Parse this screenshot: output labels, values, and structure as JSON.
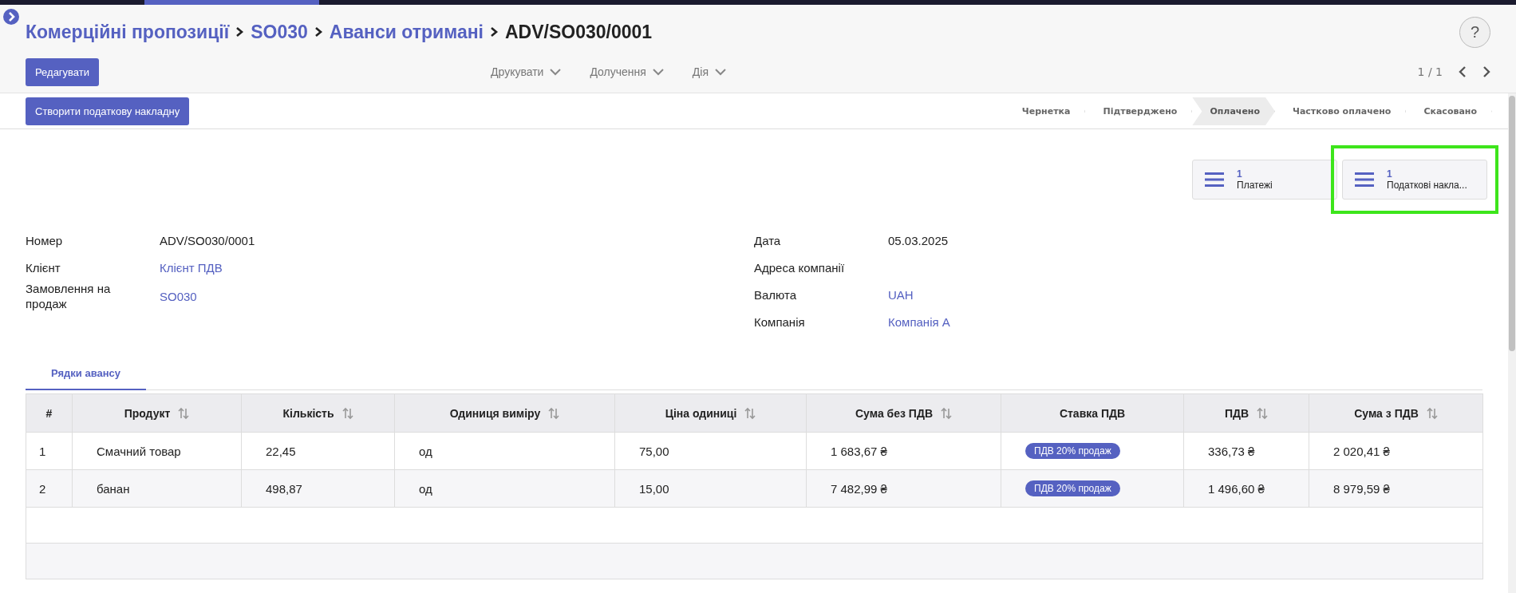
{
  "breadcrumbs": [
    {
      "label": "Комерційні пропозиції",
      "current": false
    },
    {
      "label": "SO030",
      "current": false
    },
    {
      "label": "Аванси отримані",
      "current": false
    },
    {
      "label": "ADV/SO030/0001",
      "current": true
    }
  ],
  "edit_button": "Редагувати",
  "menus": [
    "Друкувати",
    "Долучення",
    "Дія"
  ],
  "help": "?",
  "pager": "1 / 1",
  "action_button": "Створити податкову накладну",
  "statuses": [
    {
      "label": "Чернетка",
      "selected": false
    },
    {
      "label": "Підтверджено",
      "selected": false
    },
    {
      "label": "Оплачено",
      "selected": true
    },
    {
      "label": "Частково оплачено",
      "selected": false
    },
    {
      "label": "Скасовано",
      "selected": false
    }
  ],
  "smart_buttons": [
    {
      "count": "1",
      "label": "Платежі",
      "highlighted": false
    },
    {
      "count": "1",
      "label": "Податкові накла...",
      "highlighted": true
    }
  ],
  "fields_left": [
    {
      "label": "Номер",
      "value": "ADV/SO030/0001",
      "link": false
    },
    {
      "label": "Клієнт",
      "value": "Клієнт ПДВ",
      "link": true
    },
    {
      "label": "Замовлення на продаж",
      "value": "SO030",
      "link": true
    }
  ],
  "fields_right": [
    {
      "label": "Дата",
      "value": "05.03.2025",
      "link": false
    },
    {
      "label": "Адреса компанії"
    },
    {
      "label": "Валюта",
      "value": "UAH",
      "link": true
    },
    {
      "label": "Компанія",
      "value": "Компанія А",
      "link": true
    }
  ],
  "tabs": [
    {
      "label": "Рядки авансу",
      "selected": true
    }
  ],
  "table": {
    "columns": [
      {
        "label": "#",
        "sortable": false
      },
      {
        "label": "Продукт",
        "sortable": true
      },
      {
        "label": "Кількість",
        "sortable": true
      },
      {
        "label": "Одиниця виміру",
        "sortable": true
      },
      {
        "label": "Ціна одиниці",
        "sortable": true
      },
      {
        "label": "Сума без ПДВ",
        "sortable": true
      },
      {
        "label": "Ставка ПДВ",
        "sortable": false
      },
      {
        "label": "ПДВ",
        "sortable": true
      },
      {
        "label": "Сума з ПДВ",
        "sortable": true
      }
    ],
    "rows": [
      {
        "cells": [
          "1",
          "Смачний товар",
          "22,45",
          "од",
          "75,00",
          "1 683,67 ₴",
          "",
          "336,73 ₴",
          "2 020,41 ₴"
        ],
        "tax_tag": {
          "label": "ПДВ 20% продаж",
          "color": "#5561c1"
        }
      },
      {
        "cells": [
          "2",
          "банан",
          "498,87",
          "од",
          "15,00",
          "7 482,99 ₴",
          "",
          "1 496,60 ₴",
          "8 979,59 ₴"
        ],
        "tax_tag": {
          "label": "ПДВ 20% продаж",
          "color": "#5561c1"
        }
      }
    ]
  }
}
